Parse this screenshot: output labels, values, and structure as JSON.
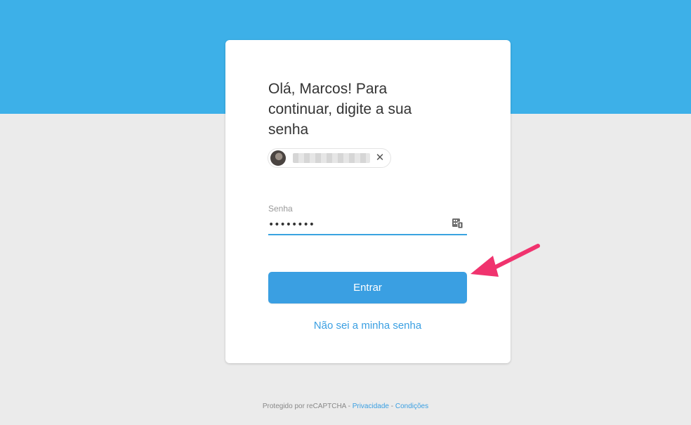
{
  "login": {
    "title": "Olá, Marcos! Para continuar, digite a sua senha",
    "user_chip": {
      "close_glyph": "✕"
    },
    "password": {
      "label": "Senha",
      "value": "••••••••"
    },
    "submit_label": "Entrar",
    "forgot_label": "Não sei a minha senha"
  },
  "footer": {
    "text": "Protegido por reCAPTCHA",
    "separator1": " - ",
    "privacy": "Privacidade",
    "separator2": " - ",
    "terms": "Condições"
  },
  "icons": {
    "close": "close-icon",
    "password_manager": "key-icon",
    "annotation_arrow": "arrow-icon"
  },
  "colors": {
    "header_band": "#3db0e8",
    "background": "#ebebeb",
    "primary": "#3a9fe2",
    "arrow": "#f0336e"
  }
}
